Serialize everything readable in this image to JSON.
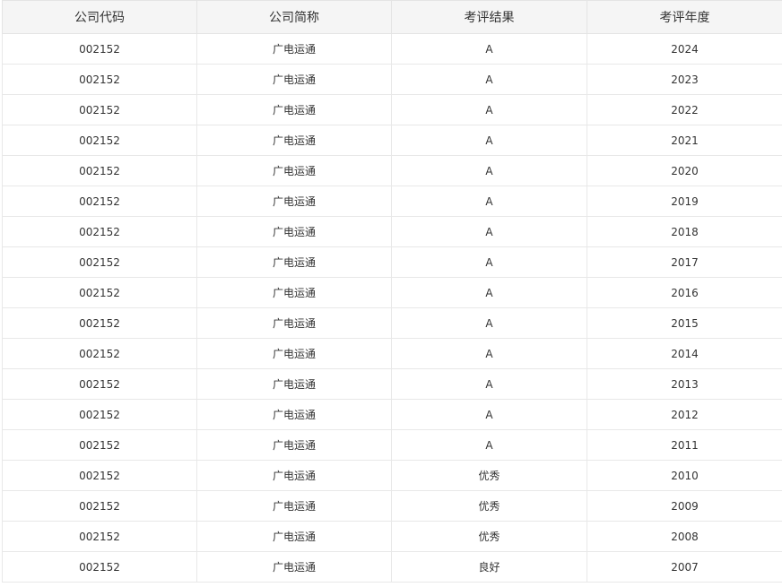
{
  "table": {
    "columns": [
      "公司代码",
      "公司简称",
      "考评结果",
      "考评年度"
    ],
    "rows": [
      [
        "002152",
        "广电运通",
        "A",
        "2024"
      ],
      [
        "002152",
        "广电运通",
        "A",
        "2023"
      ],
      [
        "002152",
        "广电运通",
        "A",
        "2022"
      ],
      [
        "002152",
        "广电运通",
        "A",
        "2021"
      ],
      [
        "002152",
        "广电运通",
        "A",
        "2020"
      ],
      [
        "002152",
        "广电运通",
        "A",
        "2019"
      ],
      [
        "002152",
        "广电运通",
        "A",
        "2018"
      ],
      [
        "002152",
        "广电运通",
        "A",
        "2017"
      ],
      [
        "002152",
        "广电运通",
        "A",
        "2016"
      ],
      [
        "002152",
        "广电运通",
        "A",
        "2015"
      ],
      [
        "002152",
        "广电运通",
        "A",
        "2014"
      ],
      [
        "002152",
        "广电运通",
        "A",
        "2013"
      ],
      [
        "002152",
        "广电运通",
        "A",
        "2012"
      ],
      [
        "002152",
        "广电运通",
        "A",
        "2011"
      ],
      [
        "002152",
        "广电运通",
        "优秀",
        "2010"
      ],
      [
        "002152",
        "广电运通",
        "优秀",
        "2009"
      ],
      [
        "002152",
        "广电运通",
        "优秀",
        "2008"
      ],
      [
        "002152",
        "广电运通",
        "良好",
        "2007"
      ]
    ]
  },
  "colors": {
    "header_bg": "#f5f5f5",
    "border": "#e8e8e8",
    "text": "#333333"
  }
}
